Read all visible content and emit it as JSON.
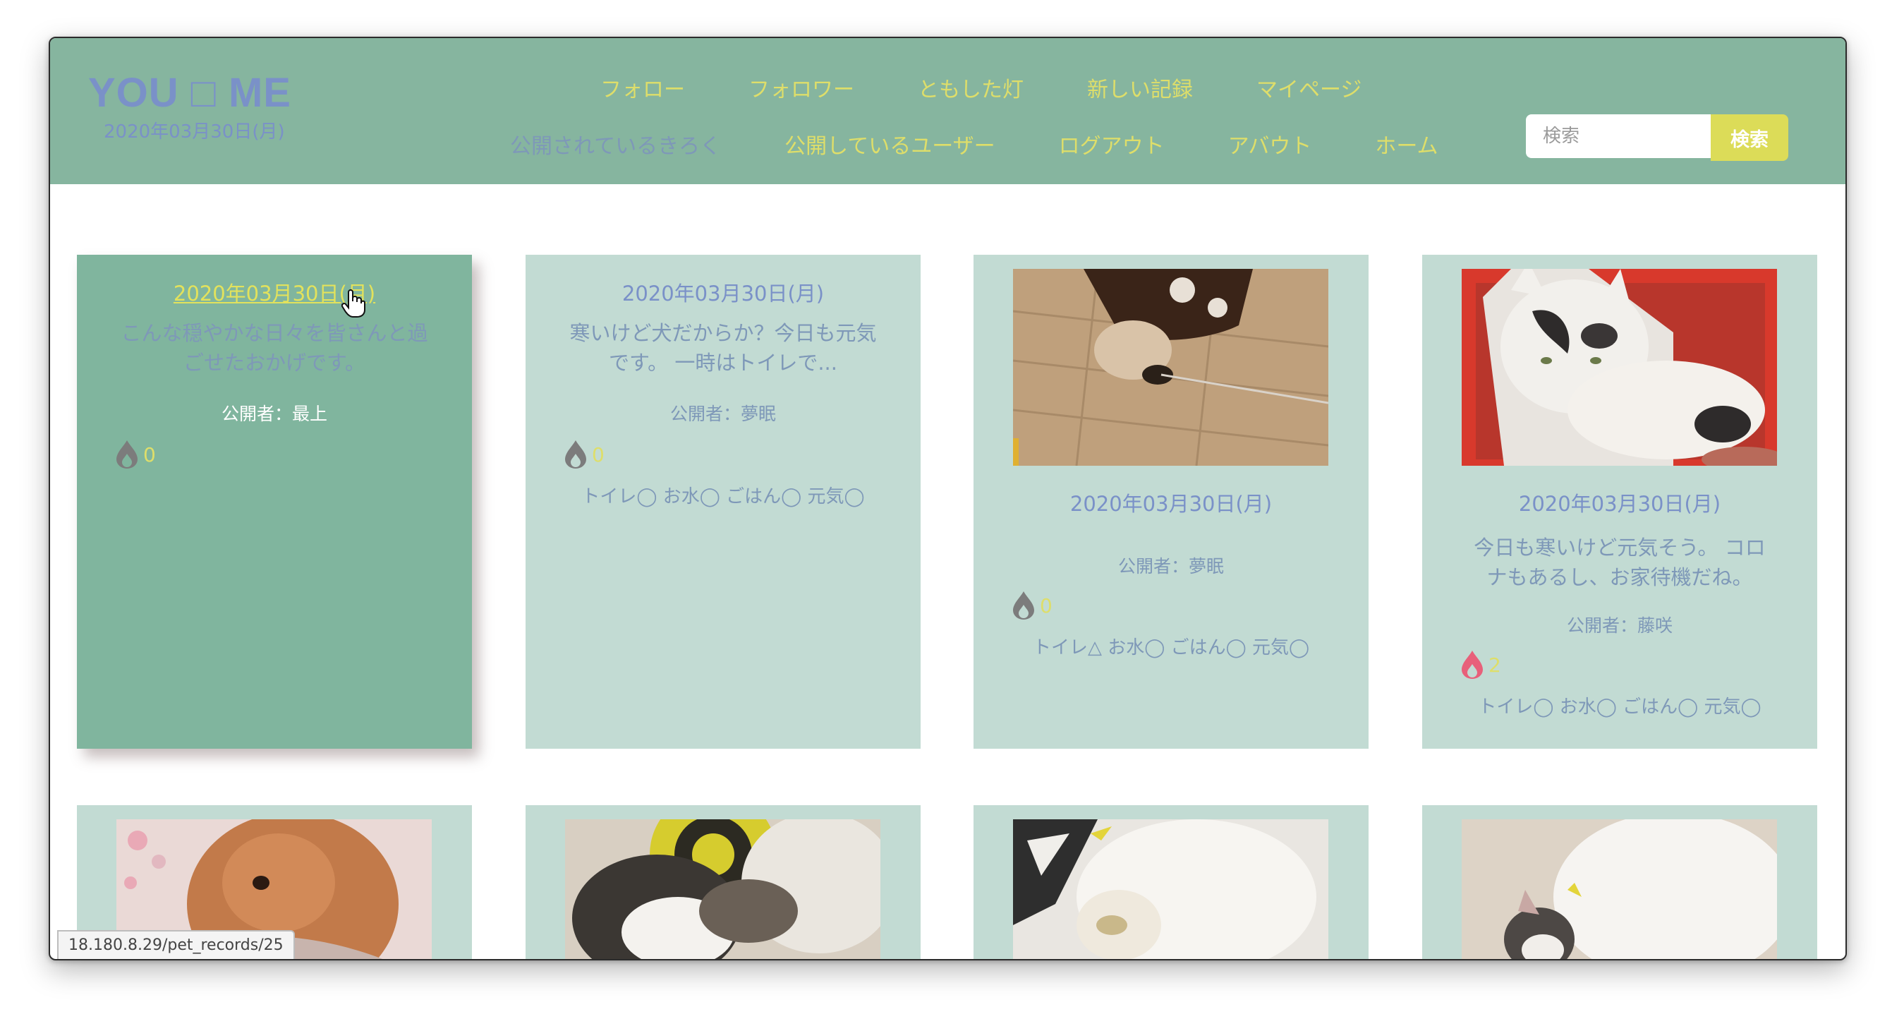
{
  "header": {
    "logo": "YOU □ ME",
    "date": "2020年03月30日(月)",
    "nav_row1": [
      {
        "label": "フォロー"
      },
      {
        "label": "フォロワー"
      },
      {
        "label": "ともした灯"
      },
      {
        "label": "新しい記録"
      },
      {
        "label": "マイページ"
      }
    ],
    "nav_row2": [
      {
        "label": "公開されているきろく"
      },
      {
        "label": "公開しているユーザー"
      },
      {
        "label": "ログアウト"
      },
      {
        "label": "アバウト"
      },
      {
        "label": "ホーム"
      }
    ],
    "search": {
      "placeholder": "検索",
      "button_label": "検索"
    }
  },
  "cards": [
    {
      "date": "2020年03月30日(月)",
      "body": "こんな穏やかな日々を皆さんと過ごせたおかげです。",
      "author": "公開者：最上",
      "likes": "0",
      "status": "",
      "photo": ""
    },
    {
      "date": "2020年03月30日(月)",
      "body": "寒いけど犬だからか？今日も元気です。 一時はトイレで...",
      "author": "公開者：夢眠",
      "likes": "0",
      "status": "トイレ◯ お水◯ ごはん◯ 元気◯",
      "photo": ""
    },
    {
      "date": "2020年03月30日(月)",
      "body": "",
      "author": "公開者：夢眠",
      "likes": "0",
      "status": "トイレ△ お水◯ ごはん◯ 元気◯",
      "photo": "dog-photo"
    },
    {
      "date": "2020年03月30日(月)",
      "body": "今日も寒いけど元気そう。 コロナもあるし、お家待機だね。",
      "author": "公開者：藤咲",
      "likes": "2",
      "status": "トイレ◯ お水◯ ごはん◯ 元気◯",
      "photo": "cat-photo"
    }
  ],
  "second_row_photos": [
    "rabbit-photo",
    "sleeping-cat-photo",
    "white-cat-photo",
    "cat-on-blanket-photo"
  ],
  "statusbar": {
    "url": "18.180.8.29/pet_records/25"
  },
  "colors": {
    "header_bg": "#86b59f",
    "card_bg": "#c2dbd3",
    "card_active_bg": "#80b59e",
    "nav_link": "#dede6a",
    "text_blue": "#7a91c8",
    "search_button": "#dcdc58",
    "like_icon_inactive": "#7c7c7c",
    "like_icon_active": "#e8607a"
  }
}
